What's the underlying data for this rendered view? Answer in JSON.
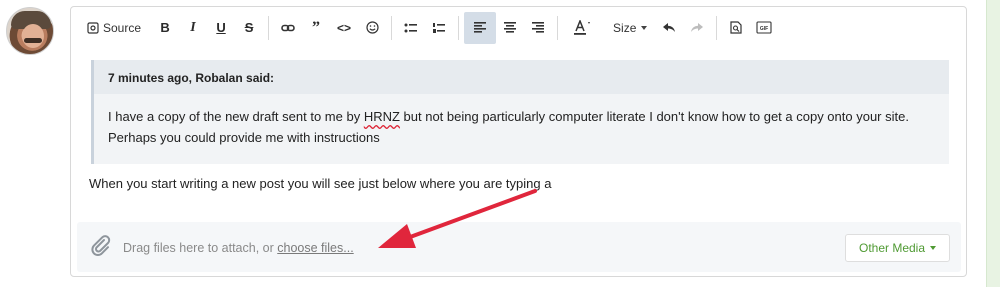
{
  "toolbar": {
    "source_label": "Source",
    "size_label": "Size",
    "buttons": [
      "source",
      "bold",
      "italic",
      "underline",
      "strikethrough",
      "link",
      "quote",
      "code",
      "emoji",
      "bulleted-list",
      "numbered-list",
      "align-left",
      "align-center",
      "align-right",
      "text-color",
      "size",
      "undo",
      "redo",
      "preview",
      "gif"
    ]
  },
  "quote": {
    "header": "7 minutes ago, Robalan said:",
    "body_before": "I have a copy of the new draft sent to me by ",
    "body_misspelled": "HRNZ",
    "body_after": " but not being particularly computer literate I don't know how to get a copy onto your site. Perhaps you could provide me with instructions"
  },
  "post": {
    "text": "When you start writing a new post you will see just below where you are typing a"
  },
  "attachments": {
    "prompt": "Drag files here to attach, or ",
    "link": "choose files...",
    "other_media": "Other Media"
  },
  "colors": {
    "accent_green": "#4f9a33",
    "annotation_arrow": "#e0263c"
  }
}
